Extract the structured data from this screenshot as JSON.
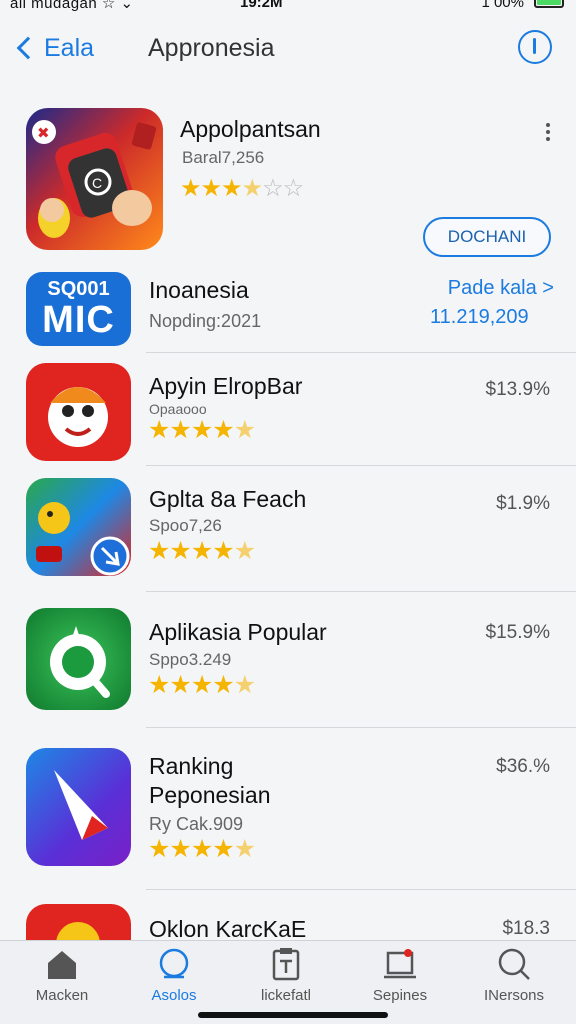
{
  "status_bar": {
    "carrier": "all mudagan ☆ ⌄",
    "time": "19:2M",
    "battery": "1 00%"
  },
  "nav": {
    "back_label": "Eala",
    "title": "Appronesia"
  },
  "featured": {
    "name": "Appolpantsan",
    "subtitle": "Baral7,256",
    "rating_stars": 3.5,
    "download_label": "DOCHANI"
  },
  "promo": {
    "badge_top": "SQ001",
    "badge_main": "MIC",
    "title": "Inoanesia",
    "subtitle": "Nopding:2021",
    "link_label": "Pade kala >",
    "count": "11.219,209"
  },
  "apps": [
    {
      "name": "Apyin ElropBar",
      "sub": "Opaaooo",
      "stars": "4.5",
      "price": "$13.9%"
    },
    {
      "name": "Gplta 8a Feach",
      "sub": "Spoo7,26",
      "stars": "4.5",
      "price": "$1.9%"
    },
    {
      "name": "Aplikasia Popular",
      "sub": "Sppo3.249",
      "stars": "4.5",
      "price": "$15.9%"
    },
    {
      "name_line1": "Ranking",
      "name_line2": "Peponesian",
      "sub": "Ry Cak.909",
      "stars": "4.5",
      "price": "$36.%"
    },
    {
      "name": "Oklon KarcKaE",
      "price": "$18.3"
    }
  ],
  "tabs": [
    {
      "label": "Macken",
      "icon": "home-icon"
    },
    {
      "label": "Asolos",
      "icon": "apps-icon"
    },
    {
      "label": "lickefatl",
      "icon": "clipboard-icon"
    },
    {
      "label": "Sepines",
      "icon": "tray-icon"
    },
    {
      "label": "INersons",
      "icon": "search-icon"
    }
  ],
  "colors": {
    "accent": "#1b7be0",
    "star": "#f5b400",
    "background": "#f4f5f7"
  }
}
